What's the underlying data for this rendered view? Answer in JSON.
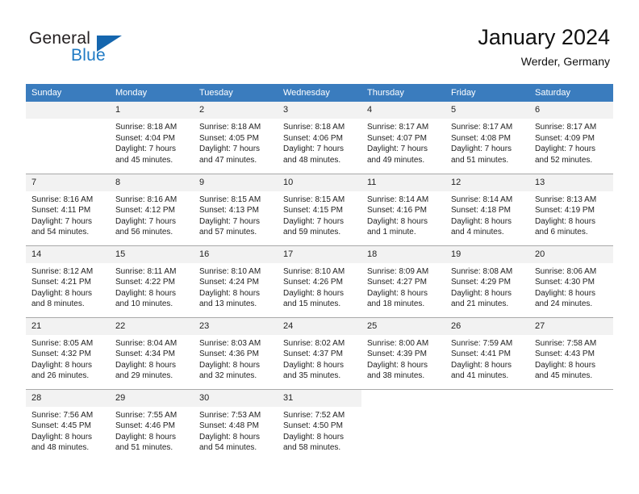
{
  "brand": {
    "word1": "General",
    "word2": "Blue",
    "triangle_color": "#1566ae",
    "blue_color": "#1f7ac4"
  },
  "header": {
    "title": "January 2024",
    "subtitle": "Werder, Germany",
    "header_bg": "#3a7cbe",
    "header_text_color": "#ffffff",
    "daynum_bg": "#f2f2f2",
    "row_separator_color": "#a9a9a9"
  },
  "weekdays": [
    "Sunday",
    "Monday",
    "Tuesday",
    "Wednesday",
    "Thursday",
    "Friday",
    "Saturday"
  ],
  "weeks": [
    {
      "days": [
        {
          "num": "",
          "l1": "",
          "l2": "",
          "l3": "",
          "l4": ""
        },
        {
          "num": "1",
          "l1": "Sunrise: 8:18 AM",
          "l2": "Sunset: 4:04 PM",
          "l3": "Daylight: 7 hours",
          "l4": "and 45 minutes."
        },
        {
          "num": "2",
          "l1": "Sunrise: 8:18 AM",
          "l2": "Sunset: 4:05 PM",
          "l3": "Daylight: 7 hours",
          "l4": "and 47 minutes."
        },
        {
          "num": "3",
          "l1": "Sunrise: 8:18 AM",
          "l2": "Sunset: 4:06 PM",
          "l3": "Daylight: 7 hours",
          "l4": "and 48 minutes."
        },
        {
          "num": "4",
          "l1": "Sunrise: 8:17 AM",
          "l2": "Sunset: 4:07 PM",
          "l3": "Daylight: 7 hours",
          "l4": "and 49 minutes."
        },
        {
          "num": "5",
          "l1": "Sunrise: 8:17 AM",
          "l2": "Sunset: 4:08 PM",
          "l3": "Daylight: 7 hours",
          "l4": "and 51 minutes."
        },
        {
          "num": "6",
          "l1": "Sunrise: 8:17 AM",
          "l2": "Sunset: 4:09 PM",
          "l3": "Daylight: 7 hours",
          "l4": "and 52 minutes."
        }
      ]
    },
    {
      "days": [
        {
          "num": "7",
          "l1": "Sunrise: 8:16 AM",
          "l2": "Sunset: 4:11 PM",
          "l3": "Daylight: 7 hours",
          "l4": "and 54 minutes."
        },
        {
          "num": "8",
          "l1": "Sunrise: 8:16 AM",
          "l2": "Sunset: 4:12 PM",
          "l3": "Daylight: 7 hours",
          "l4": "and 56 minutes."
        },
        {
          "num": "9",
          "l1": "Sunrise: 8:15 AM",
          "l2": "Sunset: 4:13 PM",
          "l3": "Daylight: 7 hours",
          "l4": "and 57 minutes."
        },
        {
          "num": "10",
          "l1": "Sunrise: 8:15 AM",
          "l2": "Sunset: 4:15 PM",
          "l3": "Daylight: 7 hours",
          "l4": "and 59 minutes."
        },
        {
          "num": "11",
          "l1": "Sunrise: 8:14 AM",
          "l2": "Sunset: 4:16 PM",
          "l3": "Daylight: 8 hours",
          "l4": "and 1 minute."
        },
        {
          "num": "12",
          "l1": "Sunrise: 8:14 AM",
          "l2": "Sunset: 4:18 PM",
          "l3": "Daylight: 8 hours",
          "l4": "and 4 minutes."
        },
        {
          "num": "13",
          "l1": "Sunrise: 8:13 AM",
          "l2": "Sunset: 4:19 PM",
          "l3": "Daylight: 8 hours",
          "l4": "and 6 minutes."
        }
      ]
    },
    {
      "days": [
        {
          "num": "14",
          "l1": "Sunrise: 8:12 AM",
          "l2": "Sunset: 4:21 PM",
          "l3": "Daylight: 8 hours",
          "l4": "and 8 minutes."
        },
        {
          "num": "15",
          "l1": "Sunrise: 8:11 AM",
          "l2": "Sunset: 4:22 PM",
          "l3": "Daylight: 8 hours",
          "l4": "and 10 minutes."
        },
        {
          "num": "16",
          "l1": "Sunrise: 8:10 AM",
          "l2": "Sunset: 4:24 PM",
          "l3": "Daylight: 8 hours",
          "l4": "and 13 minutes."
        },
        {
          "num": "17",
          "l1": "Sunrise: 8:10 AM",
          "l2": "Sunset: 4:26 PM",
          "l3": "Daylight: 8 hours",
          "l4": "and 15 minutes."
        },
        {
          "num": "18",
          "l1": "Sunrise: 8:09 AM",
          "l2": "Sunset: 4:27 PM",
          "l3": "Daylight: 8 hours",
          "l4": "and 18 minutes."
        },
        {
          "num": "19",
          "l1": "Sunrise: 8:08 AM",
          "l2": "Sunset: 4:29 PM",
          "l3": "Daylight: 8 hours",
          "l4": "and 21 minutes."
        },
        {
          "num": "20",
          "l1": "Sunrise: 8:06 AM",
          "l2": "Sunset: 4:30 PM",
          "l3": "Daylight: 8 hours",
          "l4": "and 24 minutes."
        }
      ]
    },
    {
      "days": [
        {
          "num": "21",
          "l1": "Sunrise: 8:05 AM",
          "l2": "Sunset: 4:32 PM",
          "l3": "Daylight: 8 hours",
          "l4": "and 26 minutes."
        },
        {
          "num": "22",
          "l1": "Sunrise: 8:04 AM",
          "l2": "Sunset: 4:34 PM",
          "l3": "Daylight: 8 hours",
          "l4": "and 29 minutes."
        },
        {
          "num": "23",
          "l1": "Sunrise: 8:03 AM",
          "l2": "Sunset: 4:36 PM",
          "l3": "Daylight: 8 hours",
          "l4": "and 32 minutes."
        },
        {
          "num": "24",
          "l1": "Sunrise: 8:02 AM",
          "l2": "Sunset: 4:37 PM",
          "l3": "Daylight: 8 hours",
          "l4": "and 35 minutes."
        },
        {
          "num": "25",
          "l1": "Sunrise: 8:00 AM",
          "l2": "Sunset: 4:39 PM",
          "l3": "Daylight: 8 hours",
          "l4": "and 38 minutes."
        },
        {
          "num": "26",
          "l1": "Sunrise: 7:59 AM",
          "l2": "Sunset: 4:41 PM",
          "l3": "Daylight: 8 hours",
          "l4": "and 41 minutes."
        },
        {
          "num": "27",
          "l1": "Sunrise: 7:58 AM",
          "l2": "Sunset: 4:43 PM",
          "l3": "Daylight: 8 hours",
          "l4": "and 45 minutes."
        }
      ]
    },
    {
      "days": [
        {
          "num": "28",
          "l1": "Sunrise: 7:56 AM",
          "l2": "Sunset: 4:45 PM",
          "l3": "Daylight: 8 hours",
          "l4": "and 48 minutes."
        },
        {
          "num": "29",
          "l1": "Sunrise: 7:55 AM",
          "l2": "Sunset: 4:46 PM",
          "l3": "Daylight: 8 hours",
          "l4": "and 51 minutes."
        },
        {
          "num": "30",
          "l1": "Sunrise: 7:53 AM",
          "l2": "Sunset: 4:48 PM",
          "l3": "Daylight: 8 hours",
          "l4": "and 54 minutes."
        },
        {
          "num": "31",
          "l1": "Sunrise: 7:52 AM",
          "l2": "Sunset: 4:50 PM",
          "l3": "Daylight: 8 hours",
          "l4": "and 58 minutes."
        },
        {
          "num": "",
          "l1": "",
          "l2": "",
          "l3": "",
          "l4": ""
        },
        {
          "num": "",
          "l1": "",
          "l2": "",
          "l3": "",
          "l4": ""
        },
        {
          "num": "",
          "l1": "",
          "l2": "",
          "l3": "",
          "l4": ""
        }
      ]
    }
  ]
}
